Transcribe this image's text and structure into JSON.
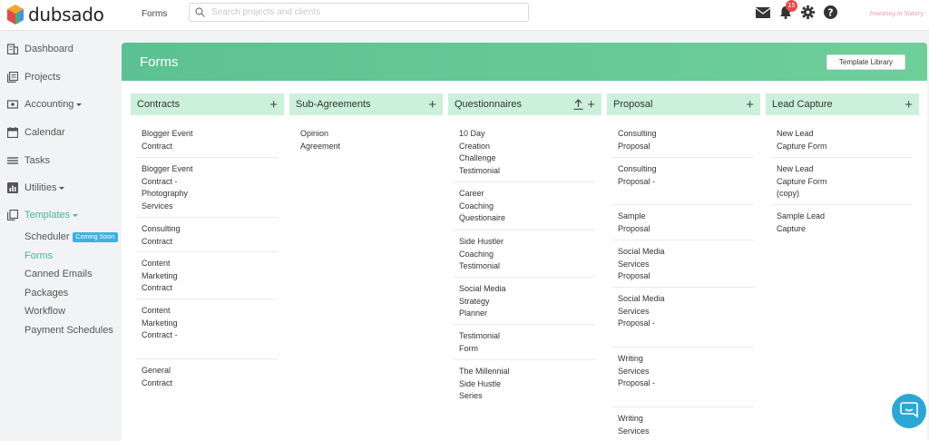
{
  "app": {
    "name": "dubsado"
  },
  "topbar": {
    "current_section": "Forms",
    "search_placeholder": "Search projects and clients",
    "notification_count": "15",
    "brand_signature": "Investing in Sistery"
  },
  "sidebar": {
    "items": [
      {
        "label": "Dashboard",
        "icon": "building-icon"
      },
      {
        "label": "Projects",
        "icon": "projects-icon"
      },
      {
        "label": "Accounting",
        "icon": "money-icon"
      },
      {
        "label": "Calendar",
        "icon": "calendar-icon"
      },
      {
        "label": "Tasks",
        "icon": "list-icon"
      },
      {
        "label": "Utilities",
        "icon": "chart-icon"
      },
      {
        "label": "Templates",
        "icon": "templates-icon"
      }
    ],
    "sub_items": [
      {
        "label": "Scheduler",
        "badge": "Coming Soon"
      },
      {
        "label": "Forms"
      },
      {
        "label": "Canned Emails"
      },
      {
        "label": "Packages"
      },
      {
        "label": "Workflow"
      },
      {
        "label": "Payment Schedules"
      }
    ]
  },
  "main": {
    "title": "Forms",
    "template_library_label": "Template Library",
    "columns": [
      {
        "title": "Contracts",
        "items": [
          "Blogger Event\nContract",
          "Blogger Event\nContract -\nPhotography\nServices",
          "Consulting\nContract",
          "Content\nMarketing\nContract",
          "Content\nMarketing\nContract -",
          "General\nContract"
        ]
      },
      {
        "title": "Sub-Agreements",
        "items": [
          "Opinion\nAgreement"
        ]
      },
      {
        "title": "Questionnaires",
        "items": [
          "10 Day\nCreation\nChallenge\nTestimonial",
          "Career\nCoaching\nQuestionaire",
          "Side Hustler\nCoaching\nTestimonial",
          "Social Media\nStrategy\nPlanner",
          "Testimonial\nForm",
          "The Millennial\nSide Hustle\nSeries"
        ]
      },
      {
        "title": "Proposal",
        "items": [
          "Consulting\nProposal",
          "Consulting\nProposal -",
          "Sample\nProposal",
          "Social Media\nServices\nProposal",
          "Social Media\nServices\nProposal -",
          "Writing\nServices\nProposal -",
          "Writing\nServices"
        ]
      },
      {
        "title": "Lead Capture",
        "items": [
          "New Lead\nCapture Form",
          "New Lead\nCapture Form\n(copy)",
          "Sample Lead\nCapture"
        ]
      }
    ]
  },
  "colors": {
    "accent": "#41b69b",
    "header_green": "#5cc192",
    "column_head": "#cbf1db",
    "badge_red": "#e8474b",
    "chat_blue": "#2aa7d5"
  }
}
